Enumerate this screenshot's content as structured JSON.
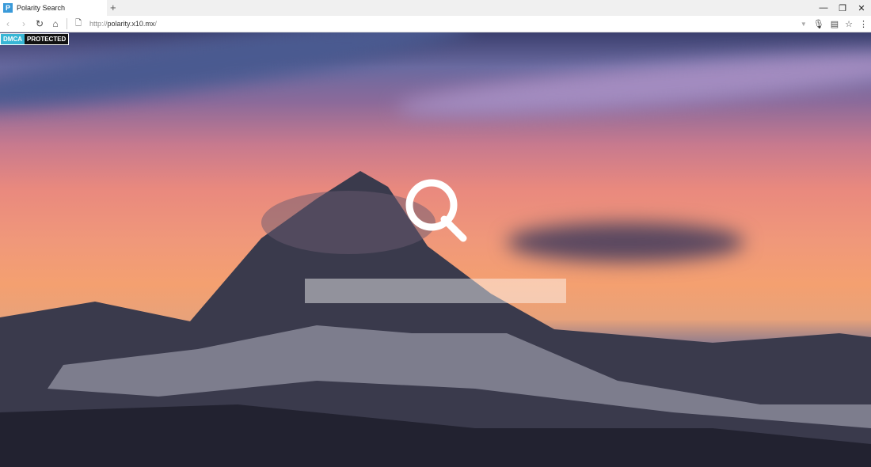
{
  "browser": {
    "tab_title": "Polarity Search",
    "favicon_letter": "P",
    "new_tab": "+",
    "url_prefix": "http://",
    "url_host": "polarity.x10.mx",
    "url_suffix": "/",
    "minimize": "—",
    "restore": "❐",
    "close": "✕"
  },
  "page": {
    "badge_left": "DMCA",
    "badge_right": "PROTECTED",
    "search_placeholder": ""
  }
}
